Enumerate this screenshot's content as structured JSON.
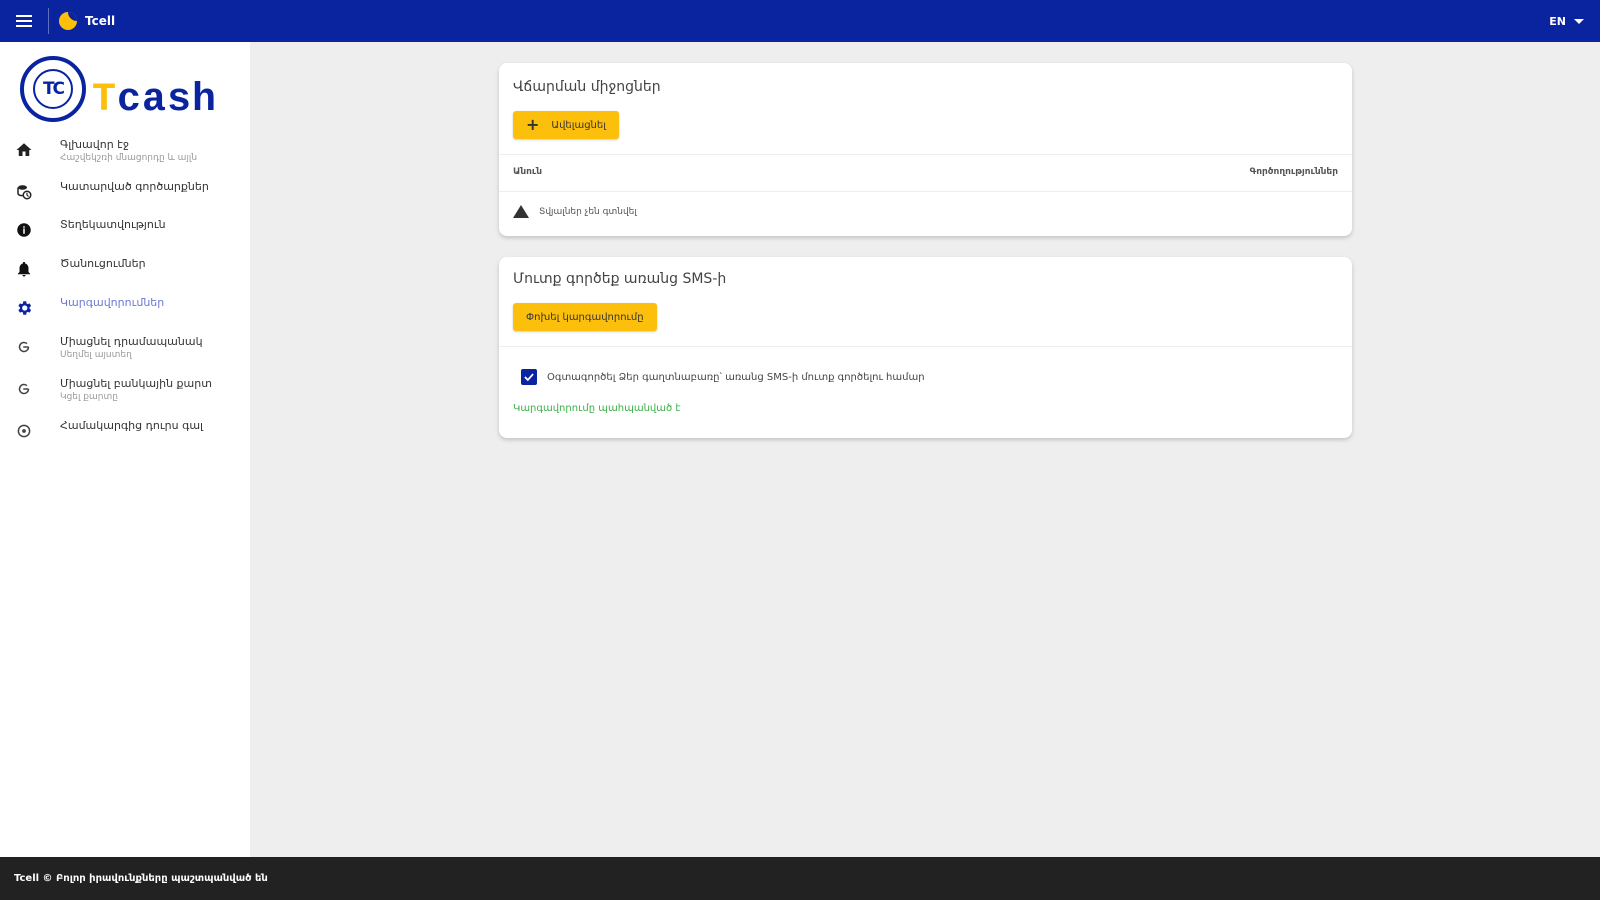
{
  "topbar": {
    "brand_name": "Tcell",
    "language": "EN"
  },
  "logo": {
    "mark": "TC",
    "wordmark_first": "T",
    "wordmark_rest": "cash"
  },
  "sidebar": {
    "items": [
      {
        "label": "Գլխավոր էջ",
        "sublabel": "Հաշվեկշռի մնացորդը և այլն",
        "icon": "home-icon"
      },
      {
        "label": "Կատարված գործարքներ",
        "sublabel": "",
        "icon": "transactions-icon"
      },
      {
        "label": "Տեղեկատվություն",
        "sublabel": "",
        "icon": "info-icon"
      },
      {
        "label": "Ծանուցումներ",
        "sublabel": "",
        "icon": "bell-icon"
      },
      {
        "label": "Կարգավորումներ",
        "sublabel": "",
        "icon": "gear-icon",
        "active": true
      },
      {
        "label": "Միացնել դրամապանակ",
        "sublabel": "Սեղմել այստեղ",
        "icon": "link-icon"
      },
      {
        "label": "Միացնել բանկային քարտ",
        "sublabel": "Կցել քարտը",
        "icon": "card-link-icon"
      },
      {
        "label": "Համակարգից դուրս գալ",
        "sublabel": "",
        "icon": "logout-icon"
      }
    ]
  },
  "cards": {
    "card1": {
      "title": "Վճարման միջոցներ",
      "add_button": "Ավելացնել",
      "col_left": "Անուն",
      "col_right": "Գործողություններ",
      "empty_text": "Տվյալներ չեն գտնվել"
    },
    "card2": {
      "title": "Մուտք գործեք առանց SMS-ի",
      "save_button": "Փոխել կարգավորումը",
      "checkbox_label": "Օգտագործել Ձեր գաղտնաբառը՝ առանց SMS-ի մուտք գործելու համար",
      "success_text": "Կարգավորումը պահպանված է"
    }
  },
  "footer": {
    "text": "Tcell © Բոլոր իրավունքները պաշտպանված են"
  },
  "colors": {
    "primary": "#0a24a0",
    "accent": "#fbbf0c",
    "success": "#3cae48"
  }
}
